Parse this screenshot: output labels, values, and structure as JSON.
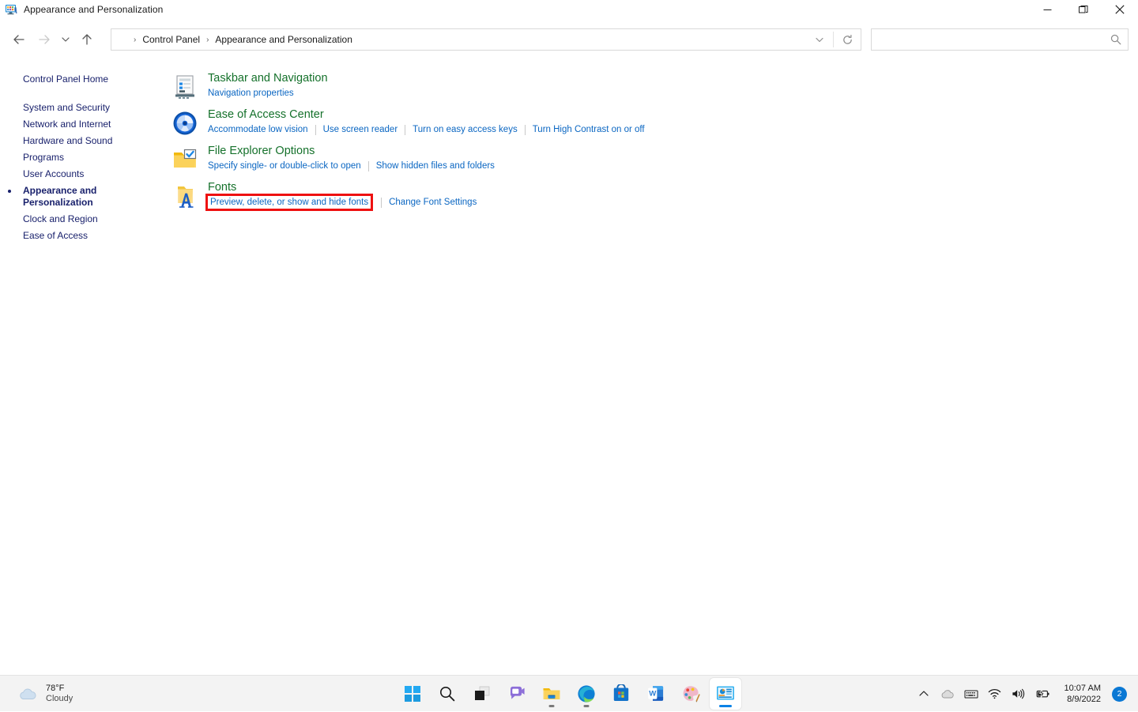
{
  "window": {
    "title": "Appearance and Personalization",
    "icon": "control-panel-icon",
    "controls": {
      "minimize": "Minimize",
      "restore": "Restore",
      "close": "Close"
    }
  },
  "toolbar": {
    "back": "Back",
    "forward": "Forward",
    "recent": "Recent locations",
    "up": "Up",
    "refresh": "Refresh",
    "address_dropdown": "Previous locations",
    "breadcrumbs": [
      "Control Panel",
      "Appearance and Personalization"
    ],
    "breadcrumb_leading_separator": "›"
  },
  "search": {
    "value": "",
    "placeholder": "",
    "icon": "search-icon"
  },
  "sidebar": {
    "home": {
      "label": "Control Panel Home"
    },
    "items": [
      {
        "label": "System and Security",
        "current": false
      },
      {
        "label": "Network and Internet",
        "current": false
      },
      {
        "label": "Hardware and Sound",
        "current": false
      },
      {
        "label": "Programs",
        "current": false
      },
      {
        "label": "User Accounts",
        "current": false
      },
      {
        "label": "Appearance and Personalization",
        "current": true
      },
      {
        "label": "Clock and Region",
        "current": false
      },
      {
        "label": "Ease of Access",
        "current": false
      }
    ]
  },
  "main": {
    "categories": [
      {
        "title": "Taskbar and Navigation",
        "icon": "taskbar-navigation-icon",
        "links": [
          {
            "label": "Navigation properties",
            "highlighted": false
          }
        ]
      },
      {
        "title": "Ease of Access Center",
        "icon": "ease-of-access-icon",
        "links": [
          {
            "label": "Accommodate low vision",
            "highlighted": false
          },
          {
            "label": "Use screen reader",
            "highlighted": false
          },
          {
            "label": "Turn on easy access keys",
            "highlighted": false
          },
          {
            "label": "Turn High Contrast on or off",
            "highlighted": false
          }
        ]
      },
      {
        "title": "File Explorer Options",
        "icon": "file-explorer-options-icon",
        "links": [
          {
            "label": "Specify single- or double-click to open",
            "highlighted": false
          },
          {
            "label": "Show hidden files and folders",
            "highlighted": false
          }
        ]
      },
      {
        "title": "Fonts",
        "icon": "fonts-icon",
        "links": [
          {
            "label": "Preview, delete, or show and hide fonts",
            "highlighted": true
          },
          {
            "label": "Change Font Settings",
            "highlighted": false
          }
        ]
      }
    ]
  },
  "taskbar": {
    "weather": {
      "temperature": "78°F",
      "condition": "Cloudy",
      "icon": "cloud-icon"
    },
    "apps": [
      {
        "name": "start-button",
        "icon": "windows-logo-icon",
        "active": false,
        "running": false
      },
      {
        "name": "search-button",
        "icon": "search-icon",
        "active": false,
        "running": false
      },
      {
        "name": "task-view-button",
        "icon": "task-view-icon",
        "active": false,
        "running": false
      },
      {
        "name": "chat-button",
        "icon": "chat-video-icon",
        "active": false,
        "running": false
      },
      {
        "name": "file-explorer-button",
        "icon": "folder-icon",
        "active": false,
        "running": true
      },
      {
        "name": "edge-button",
        "icon": "edge-icon",
        "active": false,
        "running": true
      },
      {
        "name": "microsoft-store-button",
        "icon": "store-bag-icon",
        "active": false,
        "running": false
      },
      {
        "name": "word-button",
        "icon": "word-icon",
        "active": false,
        "running": false
      },
      {
        "name": "paint-button",
        "icon": "paint-palette-icon",
        "active": false,
        "running": false
      },
      {
        "name": "control-panel-button",
        "icon": "control-panel-icon",
        "active": true,
        "running": true
      }
    ],
    "tray": {
      "show_hidden": "chevron-up-icon",
      "onedrive": "cloud-icon",
      "keyboard": "keyboard-icon",
      "network": "wifi-icon",
      "volume": "speaker-icon",
      "battery": "battery-charging-icon",
      "time": "10:07 AM",
      "date": "8/9/2022",
      "notification_count": "2"
    }
  },
  "colors": {
    "category_title_green": "#15712b",
    "link_blue": "#0a66c2",
    "sidebar_navy": "#19216c",
    "highlight_red": "#ee1111",
    "accent_blue": "#0a78d4",
    "taskbar_bg": "#f3f3f3"
  }
}
